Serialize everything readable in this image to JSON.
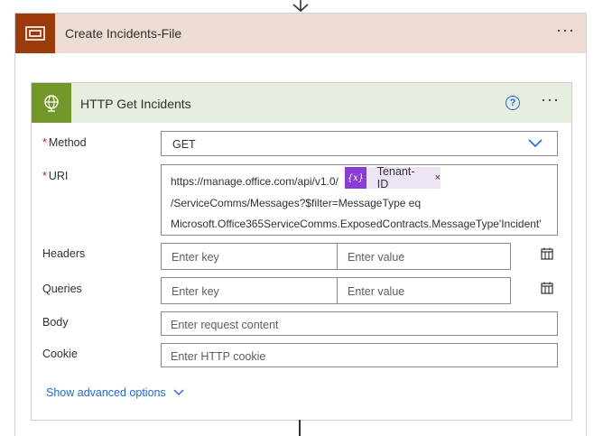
{
  "scope": {
    "title": "Create Incidents-File",
    "more": "···"
  },
  "http": {
    "title": "HTTP Get Incidents",
    "help": "?",
    "more": "···"
  },
  "form": {
    "method": {
      "required": "*",
      "label": "Method",
      "value": "GET"
    },
    "uri": {
      "required": "*",
      "label": "URI",
      "line1_prefix": "https://manage.office.com/api/v1.0/",
      "token_icon": "{x}",
      "token_label": "Tenant-ID",
      "token_close": "×",
      "line2": "/ServiceComms/Messages?$filter=MessageType eq",
      "line3": "Microsoft.Office365ServiceComms.ExposedContracts.MessageType'Incident'"
    },
    "headers": {
      "label": "Headers",
      "key_placeholder": "Enter key",
      "value_placeholder": "Enter value"
    },
    "queries": {
      "label": "Queries",
      "key_placeholder": "Enter key",
      "value_placeholder": "Enter value"
    },
    "body": {
      "label": "Body",
      "placeholder": "Enter request content"
    },
    "cookie": {
      "label": "Cookie",
      "placeholder": "Enter HTTP cookie"
    }
  },
  "advanced_label": "Show advanced options",
  "colors": {
    "scope_accent": "#9b3b0a",
    "scope_header": "#eddcd4",
    "http_accent": "#709727",
    "http_header": "#e6eedf",
    "link": "#2266e3",
    "token_icon": "#8b3bd6",
    "token_bg": "#ede4f6",
    "required": "#a4262c"
  },
  "icons": {
    "scope": "scope-bracket-icon",
    "http": "globe-icon",
    "help": "help-circle-icon",
    "method_dropdown": "chevron-down-icon",
    "switch_mode": "table-switch-icon",
    "advanced": "chevron-down-icon"
  }
}
